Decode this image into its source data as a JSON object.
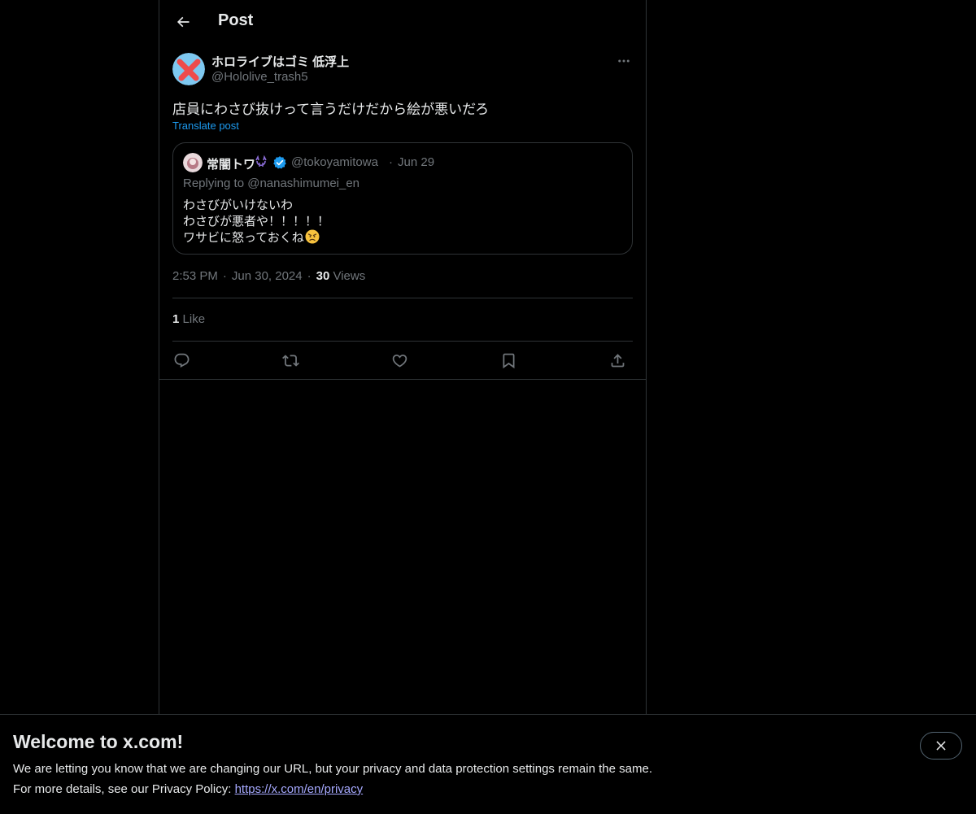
{
  "header": {
    "title": "Post"
  },
  "post": {
    "author_name": "ホロライブはゴミ 低浮上",
    "author_handle": "@Hololive_trash5",
    "text": "店員にわさび抜けって言うだけだから絵が悪いだろ",
    "translate_label": "Translate post",
    "time": "2:53 PM",
    "date": "Jun 30, 2024",
    "views_count": "30",
    "views_label": "Views",
    "likes_count": "1",
    "likes_label": "Like"
  },
  "quote": {
    "author_name": "常闇トワ",
    "author_handle": "@tokoyamitowa",
    "date": "Jun 29",
    "replying_to": "Replying to @nanashimumei_en",
    "lines": [
      "わさびがいけないわ",
      "わさびが悪者や！！！！！",
      "ワサビに怒っておくね"
    ]
  },
  "banner": {
    "title": "Welcome to x.com!",
    "line1": "We are letting you know that we are changing our URL, but your privacy and data protection settings remain the same.",
    "line2_prefix": "For more details, see our Privacy Policy: ",
    "link": "https://x.com/en/privacy"
  },
  "colors": {
    "background": "#000000",
    "text": "#e7e9ea",
    "secondary": "#71767b",
    "accent": "#1d9bf0",
    "border": "#2f3336",
    "link": "#a6a9ff"
  },
  "icons": {
    "back": "arrow-left-icon",
    "more": "more-horizontal-icon",
    "verified": "verified-badge-icon",
    "reply": "reply-icon",
    "repost": "repost-icon",
    "like": "heart-icon",
    "bookmark": "bookmark-icon",
    "share": "share-icon",
    "close": "close-icon"
  }
}
